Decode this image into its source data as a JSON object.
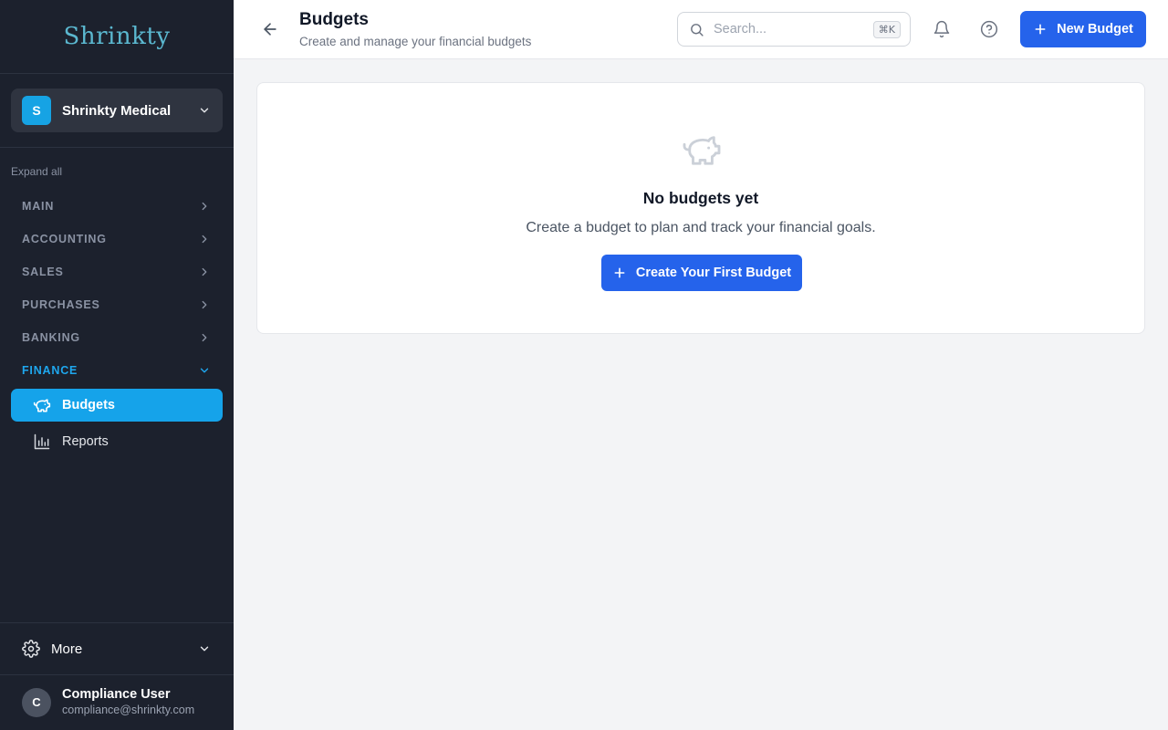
{
  "app": {
    "logo_text": "Shrinkty",
    "brand_color": "#5bb8d0"
  },
  "org": {
    "initial": "S",
    "name": "Shrinkty Medical"
  },
  "sidebar": {
    "expand_all": "Expand all",
    "sections": [
      {
        "label": "MAIN",
        "expanded": false
      },
      {
        "label": "ACCOUNTING",
        "expanded": false
      },
      {
        "label": "SALES",
        "expanded": false
      },
      {
        "label": "PURCHASES",
        "expanded": false
      },
      {
        "label": "BANKING",
        "expanded": false
      },
      {
        "label": "FINANCE",
        "expanded": true,
        "active_color": "#1ea7ee"
      }
    ],
    "items": [
      {
        "label": "Budgets",
        "icon": "piggy-bank-icon",
        "active": true
      },
      {
        "label": "Reports",
        "icon": "bar-chart-icon",
        "active": false
      }
    ],
    "more_label": "More"
  },
  "user": {
    "initial": "C",
    "name": "Compliance User",
    "email": "compliance@shrinkty.com"
  },
  "header": {
    "title": "Budgets",
    "subtitle": "Create and manage your financial budgets",
    "search_placeholder": "Search...",
    "search_shortcut": "⌘K",
    "new_button_label": "New Budget"
  },
  "empty_state": {
    "title": "No budgets yet",
    "text": "Create a budget to plan and track your financial goals.",
    "button_label": "Create Your First Budget"
  },
  "colors": {
    "primary": "#2563eb",
    "sidebar_bg": "#1c212d",
    "active_item": "#15a3ea"
  }
}
